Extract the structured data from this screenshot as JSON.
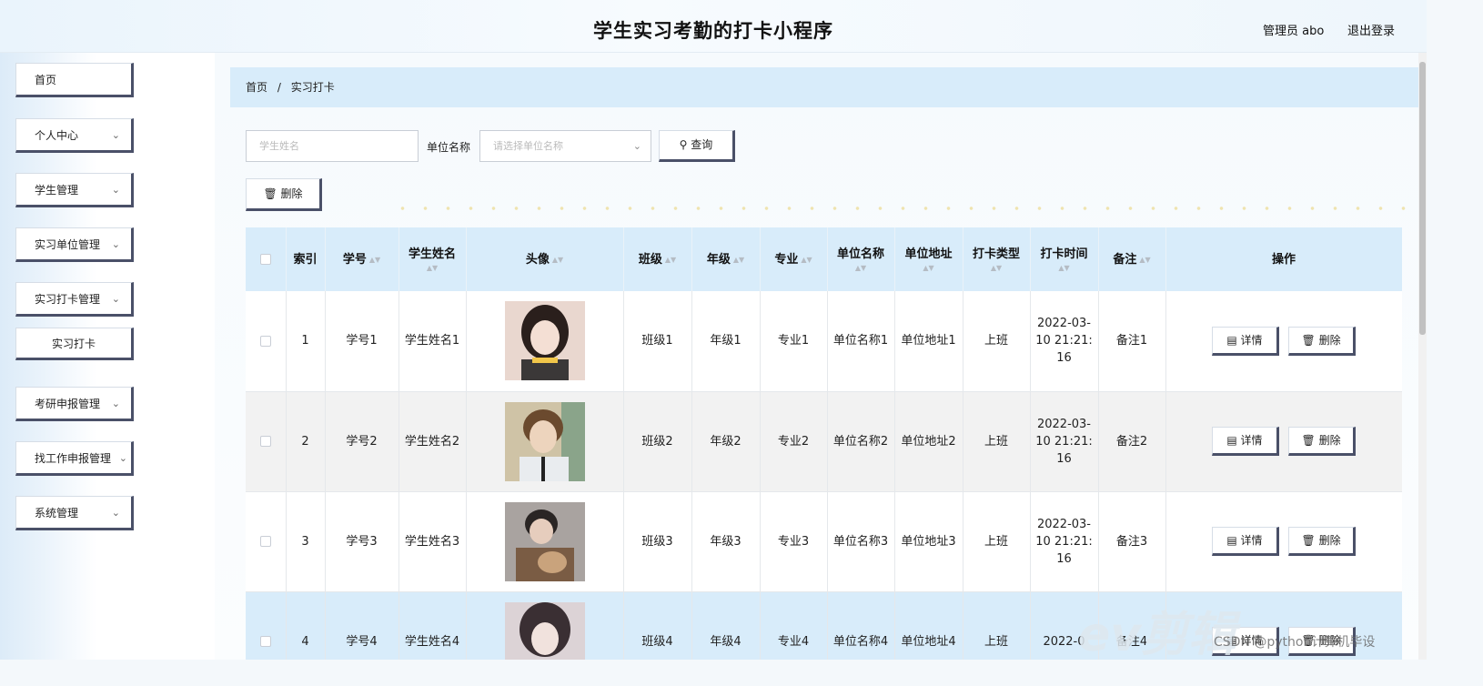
{
  "app": {
    "title": "学生实习考勤的打卡小程序",
    "user": "管理员 abo",
    "logout": "退出登录"
  },
  "sidebar": {
    "items": [
      {
        "label": "首页"
      },
      {
        "label": "个人中心"
      },
      {
        "label": "学生管理"
      },
      {
        "label": "实习单位管理"
      },
      {
        "label": "实习打卡管理"
      },
      {
        "label": "实习打卡"
      },
      {
        "label": "考研申报管理"
      },
      {
        "label": "找工作申报管理"
      },
      {
        "label": "系统管理"
      }
    ]
  },
  "breadcrumb": {
    "home": "首页",
    "separator": "/",
    "current": "实习打卡"
  },
  "search": {
    "name_placeholder": "学生姓名",
    "unit_label": "单位名称",
    "unit_placeholder": "请选择单位名称",
    "query_label": "查询",
    "delete_label": "删除"
  },
  "table": {
    "columns": [
      "索引",
      "学号",
      "学生姓名",
      "头像",
      "班级",
      "年级",
      "专业",
      "单位名称",
      "单位地址",
      "打卡类型",
      "打卡时间",
      "备注",
      "操作"
    ],
    "rows": [
      {
        "index": "1",
        "student_no": "学号1",
        "name": "学生姓名1",
        "class": "班级1",
        "grade": "年级1",
        "major": "专业1",
        "unit_name": "单位名称1",
        "unit_addr": "单位地址1",
        "type": "上班",
        "time": "2022-03-10 21:21:16",
        "remark": "备注1"
      },
      {
        "index": "2",
        "student_no": "学号2",
        "name": "学生姓名2",
        "class": "班级2",
        "grade": "年级2",
        "major": "专业2",
        "unit_name": "单位名称2",
        "unit_addr": "单位地址2",
        "type": "上班",
        "time": "2022-03-10 21:21:16",
        "remark": "备注2"
      },
      {
        "index": "3",
        "student_no": "学号3",
        "name": "学生姓名3",
        "class": "班级3",
        "grade": "年级3",
        "major": "专业3",
        "unit_name": "单位名称3",
        "unit_addr": "单位地址3",
        "type": "上班",
        "time": "2022-03-10 21:21:16",
        "remark": "备注3"
      },
      {
        "index": "4",
        "student_no": "学号4",
        "name": "学生姓名4",
        "class": "班级4",
        "grade": "年级4",
        "major": "专业4",
        "unit_name": "单位名称4",
        "unit_addr": "单位地址4",
        "type": "上班",
        "time": "2022-0",
        "remark": "备注4"
      }
    ],
    "detail_label": "详情",
    "delete_label": "删除"
  },
  "watermark": "CSDN @python计算机毕设",
  "ev_logo": "ev剪辑",
  "colors": {
    "accent": "#d8ecfa",
    "button_shadow": "#4a5068"
  }
}
